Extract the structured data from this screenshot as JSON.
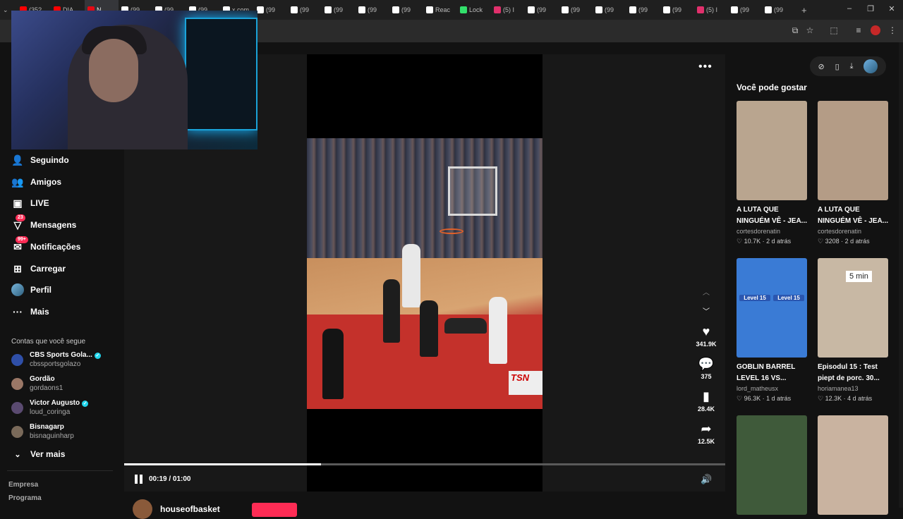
{
  "browser": {
    "tabs": [
      {
        "label": "(35?",
        "color": "#ff0000"
      },
      {
        "label": "DIA",
        "color": "#ff0000"
      },
      {
        "label": "N",
        "color": "#e50914",
        "active": true
      },
      {
        "label": "(99",
        "color": "#ffffff"
      },
      {
        "label": "(99",
        "color": "#ffffff"
      },
      {
        "label": "(99",
        "color": "#ffffff"
      },
      {
        "label": "x.com",
        "color": "#ffffff"
      },
      {
        "label": "(99",
        "color": "#ffffff"
      },
      {
        "label": "(99",
        "color": "#ffffff"
      },
      {
        "label": "(99",
        "color": "#ffffff"
      },
      {
        "label": "(99",
        "color": "#ffffff"
      },
      {
        "label": "(99",
        "color": "#ffffff"
      },
      {
        "label": "Reac",
        "color": "#ffffff"
      },
      {
        "label": "Lock",
        "color": "#32e06b"
      },
      {
        "label": "(5) I",
        "color": "#e1306c"
      },
      {
        "label": "(99",
        "color": "#ffffff"
      },
      {
        "label": "(99",
        "color": "#ffffff"
      },
      {
        "label": "(99",
        "color": "#ffffff"
      },
      {
        "label": "(99",
        "color": "#ffffff"
      },
      {
        "label": "(99",
        "color": "#ffffff"
      },
      {
        "label": "(5) I",
        "color": "#e1306c"
      },
      {
        "label": "(99",
        "color": "#ffffff"
      },
      {
        "label": "(99",
        "color": "#ffffff"
      }
    ],
    "new_tab_icon": "plus-icon"
  },
  "sidebar": {
    "items": [
      {
        "label": "Seguindo",
        "icon": "following-icon",
        "glyph": "👤"
      },
      {
        "label": "Amigos",
        "icon": "friends-icon",
        "glyph": "👥"
      },
      {
        "label": "LIVE",
        "icon": "live-icon",
        "glyph": "▣"
      },
      {
        "label": "Mensagens",
        "icon": "messages-icon",
        "glyph": "▽",
        "badge": "23"
      },
      {
        "label": "Notificações",
        "icon": "notifications-icon",
        "glyph": "✉",
        "badge": "99+"
      },
      {
        "label": "Carregar",
        "icon": "upload-icon",
        "glyph": "⊞"
      },
      {
        "label": "Perfil",
        "icon": "profile-avatar",
        "glyph": ""
      },
      {
        "label": "Mais",
        "icon": "more-icon",
        "glyph": "···"
      }
    ],
    "following_title": "Contas que você segue",
    "accounts": [
      {
        "name": "CBS Sports Gola...",
        "handle": "cbssportsgolazo",
        "verified": true,
        "color": "#2f4fa8"
      },
      {
        "name": "Gordão",
        "handle": "gordaons1",
        "verified": false,
        "color": "#9a7766"
      },
      {
        "name": "Victor Augusto",
        "handle": "loud_coringa",
        "verified": true,
        "color": "#5a4a70"
      },
      {
        "name": "Bisnagarp",
        "handle": "bisnaguinharp",
        "verified": false,
        "color": "#7a6a5a"
      }
    ],
    "see_more": "Ver mais",
    "footer": [
      "Empresa",
      "Programa"
    ]
  },
  "player": {
    "time": "00:19 / 01:00",
    "progress": 0.327,
    "likes": "341.9K",
    "comments": "375",
    "saves": "28.4K",
    "shares": "12.5K",
    "broadcaster_logo": "TSN",
    "author": "houseofbasket"
  },
  "recommended": {
    "title": "Você pode gostar",
    "cards": [
      {
        "title": "A LUTA QUE",
        "title2": "NINGUÉM VÊ - JEA...",
        "author": "cortesdorenatin",
        "likes": "10.7K",
        "age": "2 d atrás",
        "bg": "#b9a58f"
      },
      {
        "title": "A LUTA QUE",
        "title2": "NINGUÉM VÊ - JEA...",
        "author": "cortesdorenatin",
        "likes": "3208",
        "age": "2 d atrás",
        "bg": "#b49c86"
      },
      {
        "title": "GOBLIN BARREL",
        "title2": "LEVEL 16 VS...",
        "author": "lord_matheusx",
        "likes": "96.3K",
        "age": "1 d atrás",
        "bg": "#3a7bd5"
      },
      {
        "title": "Episodul 15 : Test",
        "title2": "piept de porc. 30...",
        "author": "horiamanea13",
        "likes": "12.3K",
        "age": "4 d atrás",
        "bg": "#c8b8a4"
      },
      {
        "title": "",
        "title2": "",
        "author": "",
        "likes": "",
        "age": "",
        "bg": "#3f5a3a"
      },
      {
        "title": "",
        "title2": "",
        "author": "",
        "likes": "",
        "age": "",
        "bg": "#c9b3a0"
      }
    ],
    "card_overlay_text": [
      "Level 15",
      "Level 15",
      "5 min"
    ]
  }
}
